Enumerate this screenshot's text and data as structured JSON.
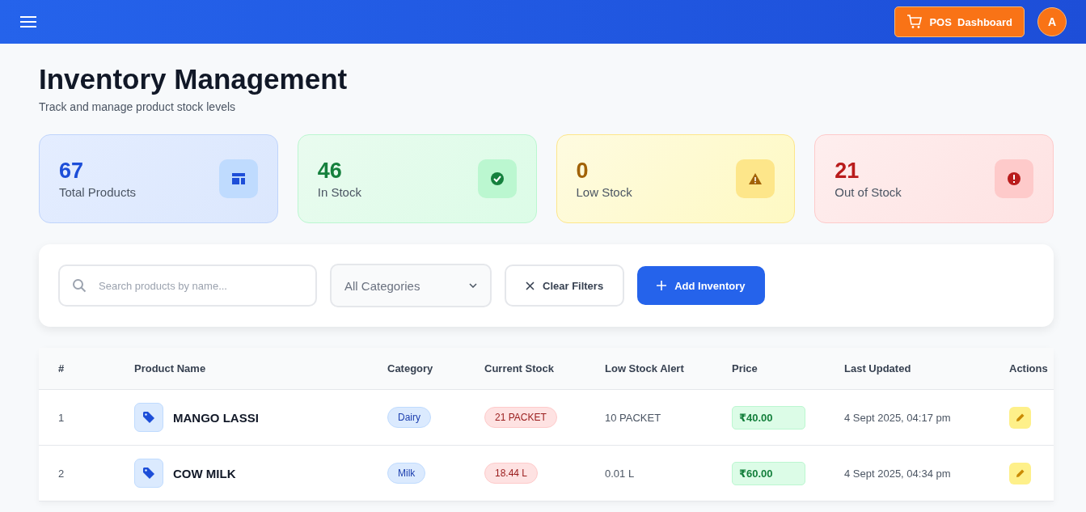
{
  "header": {
    "pos_button": "POS  Dashboard",
    "avatar": "A"
  },
  "page": {
    "title": "Inventory Management",
    "subtitle": "Track and manage product stock levels"
  },
  "stats": [
    {
      "kind": "total",
      "value": "67",
      "label": "Total Products"
    },
    {
      "kind": "in",
      "value": "46",
      "label": "In Stock"
    },
    {
      "kind": "low",
      "value": "0",
      "label": "Low Stock"
    },
    {
      "kind": "out",
      "value": "21",
      "label": "Out of Stock"
    }
  ],
  "filters": {
    "search": {
      "placeholder": "Search products by name..."
    },
    "category": {
      "value": "All Categories"
    },
    "clear_button": "Clear Filters",
    "add_button": "Add Inventory"
  },
  "table": {
    "columns": [
      "#",
      "Product Name",
      "Category",
      "Current Stock",
      "Low Stock Alert",
      "Price",
      "Last Updated",
      "Actions"
    ],
    "rows": [
      {
        "index": "1",
        "name": "MANGO LASSI",
        "category": "Dairy",
        "stock": "21 PACKET",
        "alert": "10 PACKET",
        "price": "₹40.00",
        "updated": "4 Sept 2025, 04:17 pm"
      },
      {
        "index": "2",
        "name": "COW MILK",
        "category": "Milk",
        "stock": "18.44 L",
        "alert": "0.01 L",
        "price": "₹60.00",
        "updated": "4 Sept 2025, 04:34 pm"
      }
    ]
  }
}
